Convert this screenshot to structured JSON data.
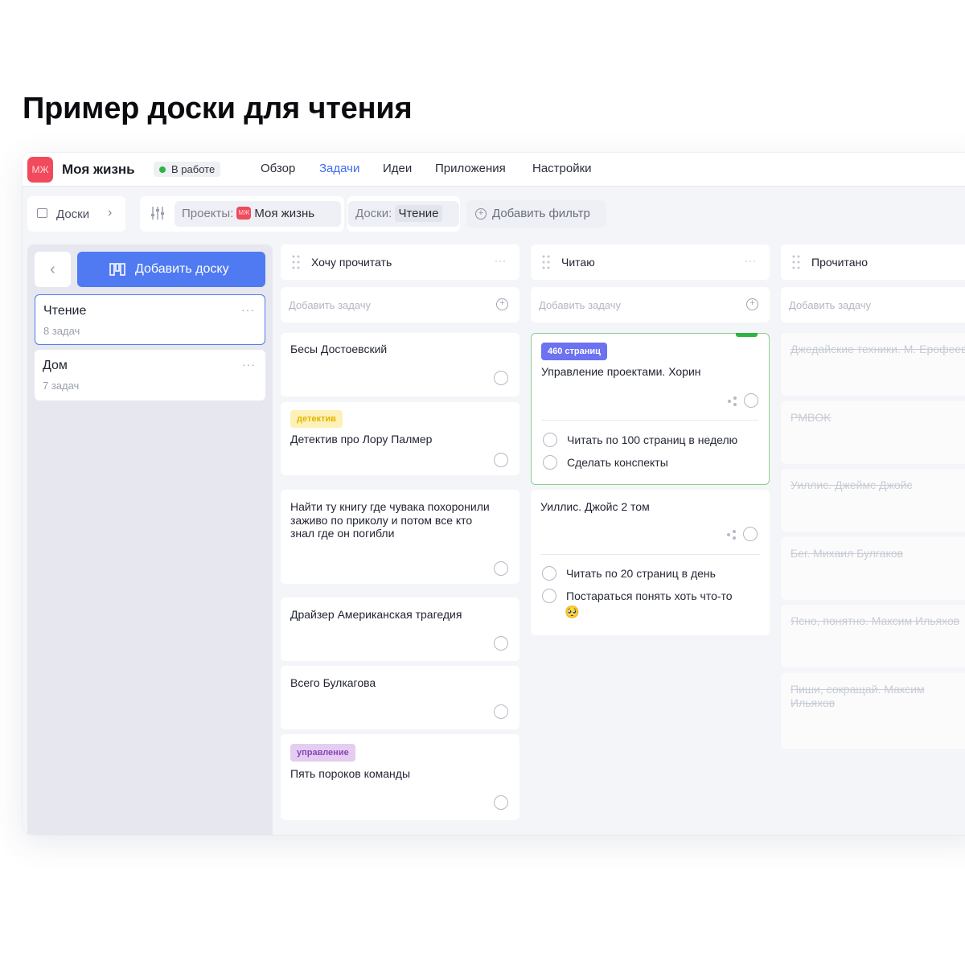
{
  "page_title": "Пример доски для чтения",
  "project": {
    "avatar": "МЖ",
    "name": "Моя жизнь",
    "status": "В работе"
  },
  "nav_tabs": [
    "Обзор",
    "Задачи",
    "Идеи",
    "Приложения",
    "Настройки"
  ],
  "active_tab": "Задачи",
  "filters": {
    "boards_label": "Доски",
    "projects_label": "Проекты:",
    "projects_avatar": "МЖ",
    "projects_value": "Моя жизнь",
    "boards_filter_label": "Доски:",
    "boards_filter_value": "Чтение",
    "add_filter": "Добавить фильтр"
  },
  "sidebar": {
    "add_board": "Добавить доску",
    "boards": [
      {
        "name": "Чтение",
        "count": "8 задач",
        "active": true
      },
      {
        "name": "Дом",
        "count": "7 задач",
        "active": false
      }
    ]
  },
  "columns": [
    {
      "title": "Хочу прочитать",
      "add_placeholder": "Добавить задачу",
      "tasks": [
        {
          "text": "Бесы Достоевский"
        },
        {
          "tag": "детектив",
          "text": "Детектив про Лору Палмер"
        },
        {
          "text": "Найти ту книгу где чувака похоронили заживо по приколу и потом все кто знал где он погибли"
        },
        {
          "text": "Драйзер Американская трагедия"
        },
        {
          "text": "Всего Булкагова"
        },
        {
          "tag": "управление",
          "text": "Пять пороков команды"
        }
      ]
    },
    {
      "title": "Читаю",
      "add_placeholder": "Добавить задачу",
      "tasks": [
        {
          "tag": "460 страниц",
          "text": "Управление проектами. Хорин",
          "subtasks": [
            "Читать по 100 страниц в неделю",
            "Сделать конспекты"
          ]
        },
        {
          "text": "Уиллис. Джойс 2 том",
          "subtasks": [
            "Читать по 20 страниц в день",
            "Постараться понять хоть что-то"
          ],
          "emoji": "🥺"
        }
      ]
    },
    {
      "title": "Прочитано",
      "add_placeholder": "Добавить задачу",
      "tasks": [
        {
          "text": "Джедайские техники. М. Ерофеев"
        },
        {
          "text": "PMBOK"
        },
        {
          "text": "Уиллис. Джеймс Джойс"
        },
        {
          "text": "Бег. Михаил Булгаков"
        },
        {
          "text": "Ясно, понятно. Максим Ильяхов"
        },
        {
          "text": "Пиши, сокращай. Максим Ильяхов"
        }
      ]
    }
  ],
  "colors": {
    "accent": "#4f7af2",
    "project": "#f04a5c",
    "status_green": "#2fb344",
    "tag_blue": "#6c72f0"
  }
}
